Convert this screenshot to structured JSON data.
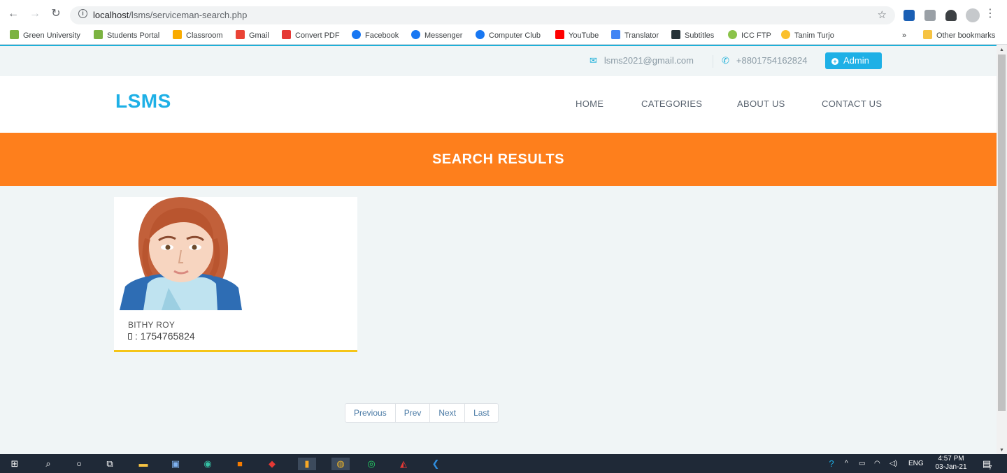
{
  "browser": {
    "url_host": "localhost",
    "url_path": "/lsms/serviceman-search.php",
    "bookmarks": [
      {
        "label": "Green University",
        "icon": "green-university-icon",
        "color": "#7cb342"
      },
      {
        "label": "Students Portal",
        "icon": "students-portal-icon",
        "color": "#7cb342"
      },
      {
        "label": "Classroom",
        "icon": "classroom-icon",
        "color": "#f9ab00"
      },
      {
        "label": "Gmail",
        "icon": "gmail-icon",
        "color": "#ea4335"
      },
      {
        "label": "Convert PDF",
        "icon": "convert-pdf-icon",
        "color": "#e53935"
      },
      {
        "label": "Facebook",
        "icon": "facebook-icon",
        "color": "#1877f2"
      },
      {
        "label": "Messenger",
        "icon": "messenger-icon",
        "color": "#1877f2"
      },
      {
        "label": "Computer Club",
        "icon": "computer-club-icon",
        "color": "#1877f2"
      },
      {
        "label": "YouTube",
        "icon": "youtube-icon",
        "color": "#ff0000"
      },
      {
        "label": "Translator",
        "icon": "translator-icon",
        "color": "#4285f4"
      },
      {
        "label": "Subtitles",
        "icon": "subtitles-icon",
        "color": "#263238"
      },
      {
        "label": "ICC FTP",
        "icon": "icc-ftp-icon",
        "color": "#8bc34a"
      },
      {
        "label": "Tanim Turjo",
        "icon": "tanim-turjo-icon",
        "color": "#fbc02d"
      }
    ],
    "overflow": "»",
    "other_bookmarks": "Other bookmarks"
  },
  "topbar": {
    "email": "lsms2021@gmail.com",
    "phone": "+8801754162824",
    "admin_label": "Admin"
  },
  "header": {
    "logo": "LSMS",
    "menu": [
      "HOME",
      "CATEGORIES",
      "ABOUT US",
      "CONTACT US"
    ]
  },
  "banner": {
    "title": "SEARCH RESULTS",
    "color": "#fe7f1c"
  },
  "results": [
    {
      "name": "BITHY ROY",
      "phone": ": 1754765824"
    }
  ],
  "pagination": [
    "Previous",
    "Prev",
    "Next",
    "Last"
  ],
  "taskbar": {
    "language": "ENG",
    "time": "4:57 PM",
    "date": "03-Jan-21",
    "notifications": "7"
  },
  "colors": {
    "accent": "#1eb0e6",
    "card_border": "#f5c518"
  }
}
